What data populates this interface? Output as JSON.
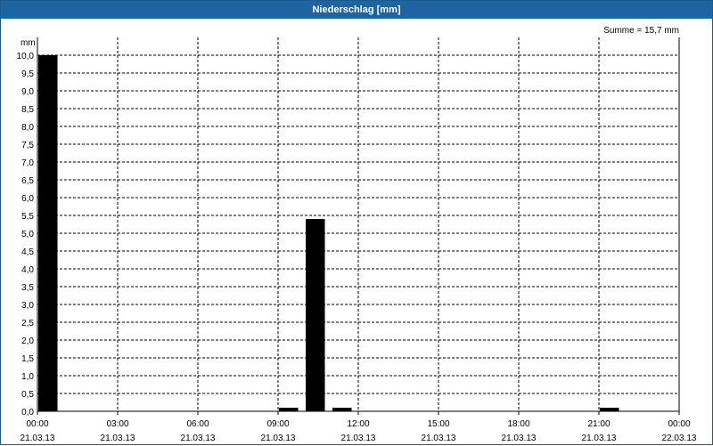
{
  "window": {
    "title": "Niederschlag [mm]"
  },
  "chart_data": {
    "type": "bar",
    "title": "Niederschlag [mm]",
    "unit_label": "mm",
    "summary": "Summe = 15,7 mm",
    "ylim": [
      0,
      10
    ],
    "y_step": 0.5,
    "y_tick_labels": [
      "0,0",
      "0,5",
      "1,0",
      "1,5",
      "2,0",
      "2,5",
      "3,0",
      "3,5",
      "4,0",
      "4,5",
      "5,0",
      "5,5",
      "6,0",
      "6,5",
      "7,0",
      "7,5",
      "8,0",
      "8,5",
      "9,0",
      "9,5",
      "10,0"
    ],
    "x_ticks": [
      {
        "time": "00:00",
        "date": "21.03.13"
      },
      {
        "time": "03:00",
        "date": "21.03.13"
      },
      {
        "time": "06:00",
        "date": "21.03.13"
      },
      {
        "time": "09:00",
        "date": "21.03.13"
      },
      {
        "time": "12:00",
        "date": "21.03.13"
      },
      {
        "time": "15:00",
        "date": "21.03.13"
      },
      {
        "time": "18:00",
        "date": "21.03.13"
      },
      {
        "time": "21:00",
        "date": "21.03.13"
      },
      {
        "time": "00:00",
        "date": "22.03.13"
      }
    ],
    "xlim": [
      "21.03.13 00:00",
      "22.03.13 00:00"
    ],
    "bars": [
      {
        "start": "21.03.13 00:00",
        "end": "21.03.13 00:45",
        "value": 10.0
      },
      {
        "start": "21.03.13 09:00",
        "end": "21.03.13 09:45",
        "value": 0.1
      },
      {
        "start": "21.03.13 10:00",
        "end": "21.03.13 10:45",
        "value": 5.4
      },
      {
        "start": "21.03.13 11:00",
        "end": "21.03.13 11:45",
        "value": 0.1
      },
      {
        "start": "21.03.13 21:00",
        "end": "21.03.13 21:45",
        "value": 0.1
      }
    ],
    "grid": true,
    "bar_color": "#000000"
  }
}
